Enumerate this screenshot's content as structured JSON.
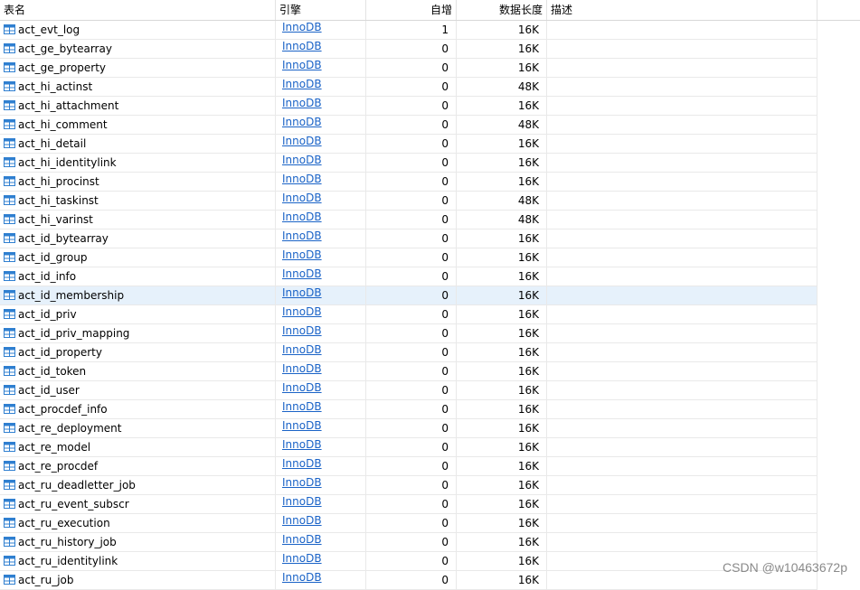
{
  "columns": {
    "name": "表名",
    "engine": "引擎",
    "auto_increment": "自增",
    "data_length": "数据长度",
    "description": "描述"
  },
  "colors": {
    "icon": "#2f7fd0",
    "link": "#1a63c7",
    "selected_row": "#e6f1fb"
  },
  "row_icon": "table-icon",
  "selected_row_index": 14,
  "rows": [
    {
      "name": "act_evt_log",
      "engine": "InnoDB",
      "auto": "1",
      "len": "16K",
      "desc": ""
    },
    {
      "name": "act_ge_bytearray",
      "engine": "InnoDB",
      "auto": "0",
      "len": "16K",
      "desc": ""
    },
    {
      "name": "act_ge_property",
      "engine": "InnoDB",
      "auto": "0",
      "len": "16K",
      "desc": ""
    },
    {
      "name": "act_hi_actinst",
      "engine": "InnoDB",
      "auto": "0",
      "len": "48K",
      "desc": ""
    },
    {
      "name": "act_hi_attachment",
      "engine": "InnoDB",
      "auto": "0",
      "len": "16K",
      "desc": ""
    },
    {
      "name": "act_hi_comment",
      "engine": "InnoDB",
      "auto": "0",
      "len": "48K",
      "desc": ""
    },
    {
      "name": "act_hi_detail",
      "engine": "InnoDB",
      "auto": "0",
      "len": "16K",
      "desc": ""
    },
    {
      "name": "act_hi_identitylink",
      "engine": "InnoDB",
      "auto": "0",
      "len": "16K",
      "desc": ""
    },
    {
      "name": "act_hi_procinst",
      "engine": "InnoDB",
      "auto": "0",
      "len": "16K",
      "desc": ""
    },
    {
      "name": "act_hi_taskinst",
      "engine": "InnoDB",
      "auto": "0",
      "len": "48K",
      "desc": ""
    },
    {
      "name": "act_hi_varinst",
      "engine": "InnoDB",
      "auto": "0",
      "len": "48K",
      "desc": ""
    },
    {
      "name": "act_id_bytearray",
      "engine": "InnoDB",
      "auto": "0",
      "len": "16K",
      "desc": ""
    },
    {
      "name": "act_id_group",
      "engine": "InnoDB",
      "auto": "0",
      "len": "16K",
      "desc": ""
    },
    {
      "name": "act_id_info",
      "engine": "InnoDB",
      "auto": "0",
      "len": "16K",
      "desc": ""
    },
    {
      "name": "act_id_membership",
      "engine": "InnoDB",
      "auto": "0",
      "len": "16K",
      "desc": ""
    },
    {
      "name": "act_id_priv",
      "engine": "InnoDB",
      "auto": "0",
      "len": "16K",
      "desc": ""
    },
    {
      "name": "act_id_priv_mapping",
      "engine": "InnoDB",
      "auto": "0",
      "len": "16K",
      "desc": ""
    },
    {
      "name": "act_id_property",
      "engine": "InnoDB",
      "auto": "0",
      "len": "16K",
      "desc": ""
    },
    {
      "name": "act_id_token",
      "engine": "InnoDB",
      "auto": "0",
      "len": "16K",
      "desc": ""
    },
    {
      "name": "act_id_user",
      "engine": "InnoDB",
      "auto": "0",
      "len": "16K",
      "desc": ""
    },
    {
      "name": "act_procdef_info",
      "engine": "InnoDB",
      "auto": "0",
      "len": "16K",
      "desc": ""
    },
    {
      "name": "act_re_deployment",
      "engine": "InnoDB",
      "auto": "0",
      "len": "16K",
      "desc": ""
    },
    {
      "name": "act_re_model",
      "engine": "InnoDB",
      "auto": "0",
      "len": "16K",
      "desc": ""
    },
    {
      "name": "act_re_procdef",
      "engine": "InnoDB",
      "auto": "0",
      "len": "16K",
      "desc": ""
    },
    {
      "name": "act_ru_deadletter_job",
      "engine": "InnoDB",
      "auto": "0",
      "len": "16K",
      "desc": ""
    },
    {
      "name": "act_ru_event_subscr",
      "engine": "InnoDB",
      "auto": "0",
      "len": "16K",
      "desc": ""
    },
    {
      "name": "act_ru_execution",
      "engine": "InnoDB",
      "auto": "0",
      "len": "16K",
      "desc": ""
    },
    {
      "name": "act_ru_history_job",
      "engine": "InnoDB",
      "auto": "0",
      "len": "16K",
      "desc": ""
    },
    {
      "name": "act_ru_identitylink",
      "engine": "InnoDB",
      "auto": "0",
      "len": "16K",
      "desc": ""
    },
    {
      "name": "act_ru_job",
      "engine": "InnoDB",
      "auto": "0",
      "len": "16K",
      "desc": ""
    }
  ],
  "watermark": "CSDN @w10463672p"
}
